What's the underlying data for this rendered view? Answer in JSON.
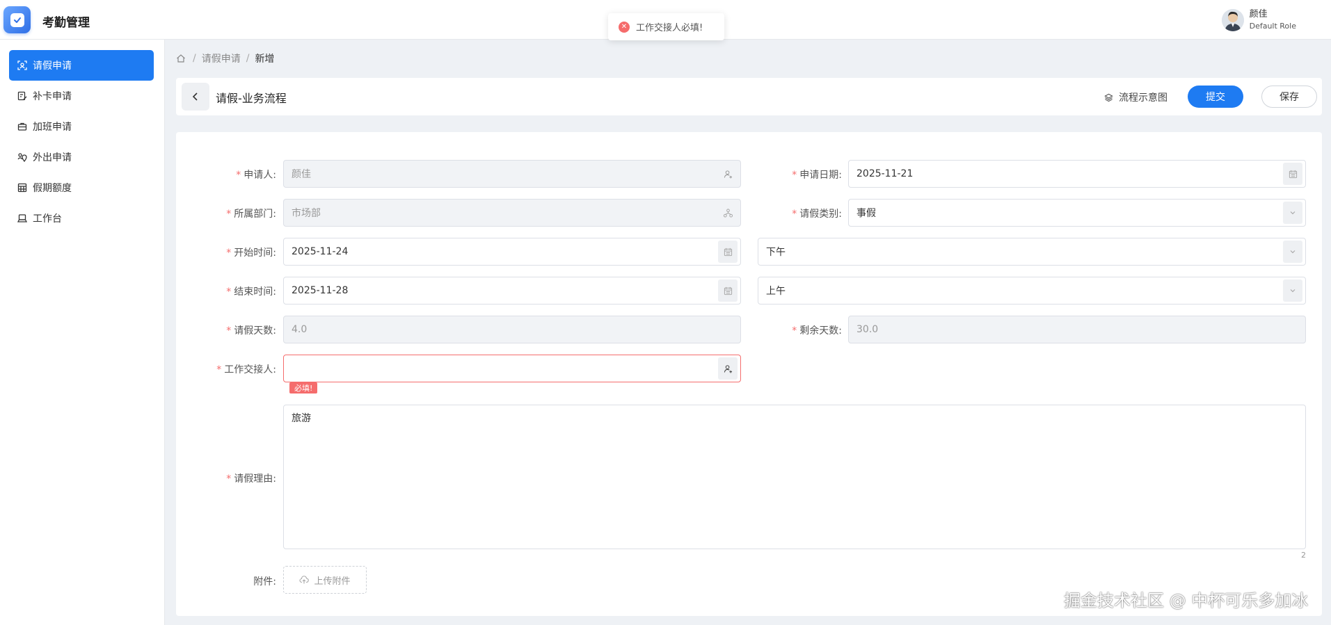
{
  "app": {
    "title": "考勤管理"
  },
  "user": {
    "name": "颜佳",
    "role": "Default Role"
  },
  "toast": {
    "message": "工作交接人必填!"
  },
  "sidebar": {
    "items": [
      {
        "label": "请假申请",
        "icon": "user-scan-icon",
        "active": true
      },
      {
        "label": "补卡申请",
        "icon": "card-edit-icon"
      },
      {
        "label": "加班申请",
        "icon": "briefcase-icon"
      },
      {
        "label": "外出申请",
        "icon": "people-location-icon"
      },
      {
        "label": "假期额度",
        "icon": "calculator-icon"
      },
      {
        "label": "工作台",
        "icon": "laptop-icon"
      }
    ]
  },
  "breadcrumb": {
    "level1": "请假申请",
    "level2": "新增",
    "separator": "/"
  },
  "titlebar": {
    "title": "请假-业务流程",
    "flow_label": "流程示意图",
    "submit_label": "提交",
    "save_label": "保存"
  },
  "form": {
    "required_mark": "*",
    "applicant": {
      "label": "申请人:",
      "value": "颜佳"
    },
    "apply_date": {
      "label": "申请日期:",
      "value": "2025-11-21"
    },
    "department": {
      "label": "所属部门:",
      "value": "市场部"
    },
    "leave_type": {
      "label": "请假类别:",
      "value": "事假"
    },
    "start_time": {
      "label": "开始时间:",
      "date": "2025-11-24",
      "period": "下午"
    },
    "end_time": {
      "label": "结束时间:",
      "date": "2025-11-28",
      "period": "上午"
    },
    "leave_days": {
      "label": "请假天数:",
      "value": "4.0"
    },
    "remaining_days": {
      "label": "剩余天数:",
      "value": "30.0"
    },
    "handover": {
      "label": "工作交接人:",
      "value": "",
      "error": "必填!"
    },
    "reason": {
      "label": "请假理由:",
      "value": "旅游",
      "count": "2"
    },
    "attachment": {
      "label": "附件:",
      "upload_label": "上传附件"
    }
  },
  "watermark": "掘金技术社区 @ 中杯可乐多加冰",
  "colors": {
    "primary": "#1e7bf2",
    "error": "#f56c6c"
  }
}
